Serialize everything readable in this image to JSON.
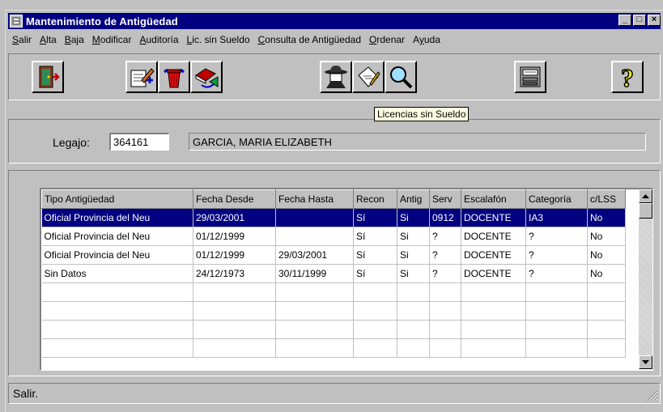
{
  "window": {
    "title": "Mantenimiento de Antigüedad",
    "controls": {
      "minimize": "_",
      "maximize": "□",
      "close": "×"
    }
  },
  "menu": [
    {
      "label": "Salir",
      "accel": "S",
      "rest": "alir"
    },
    {
      "label": "Alta",
      "accel": "A",
      "rest": "lta"
    },
    {
      "label": "Baja",
      "accel": "B",
      "rest": "aja"
    },
    {
      "label": "Modificar",
      "accel": "M",
      "rest": "odificar"
    },
    {
      "label": "Auditoría",
      "accel": "A",
      "rest": "uditoría"
    },
    {
      "label": "Lic. sin Sueldo",
      "accel": "L",
      "rest": "ic. sin Sueldo"
    },
    {
      "label": "Consulta de Antigüedad",
      "accel": "C",
      "rest": "onsulta de Antigüedad"
    },
    {
      "label": "Ordenar",
      "accel": "O",
      "rest": "rdenar"
    },
    {
      "label": "Ayuda",
      "pre": "A",
      "accel": "y",
      "rest": "uda"
    }
  ],
  "toolbar": {
    "buttons": [
      "exit-door-icon",
      "new-record-icon",
      "trash-delete-icon",
      "book-modify-icon",
      "spy-audit-icon",
      "license-document-icon",
      "magnifier-search-icon",
      "register-sort-icon",
      "help-question-icon"
    ],
    "tooltip": "Licencias sin Sueldo"
  },
  "legajo": {
    "label": "Legajo:",
    "value": "364161",
    "name": "GARCIA, MARIA ELIZABETH"
  },
  "grid": {
    "columns": [
      "Tipo Antigüedad",
      "Fecha Desde",
      "Fecha Hasta",
      "Recon",
      "Antig",
      "Serv",
      "Escalafón",
      "Categoría",
      "c/LSS"
    ],
    "rows": [
      [
        "Oficial Provincia del Neu",
        "29/03/2001",
        "",
        "Sí",
        "Si",
        "0912",
        "DOCENTE",
        "IA3",
        "No"
      ],
      [
        "Oficial Provincia del Neu",
        "01/12/1999",
        "",
        "Sí",
        "Si",
        "?",
        "DOCENTE",
        "?",
        "No"
      ],
      [
        "Oficial Provincia del Neu",
        "01/12/1999",
        "29/03/2001",
        "Sí",
        "Si",
        "?",
        "DOCENTE",
        "?",
        "No"
      ],
      [
        "Sin Datos",
        "24/12/1973",
        "30/11/1999",
        "Sí",
        "Si",
        "?",
        "DOCENTE",
        "?",
        "No"
      ]
    ],
    "selected_row": 0
  },
  "status": {
    "text": "Salir."
  },
  "colors": {
    "title_bg": "#000080",
    "face": "#c0c0c0",
    "selection": "#000080",
    "tooltip_bg": "#ffffe1"
  }
}
